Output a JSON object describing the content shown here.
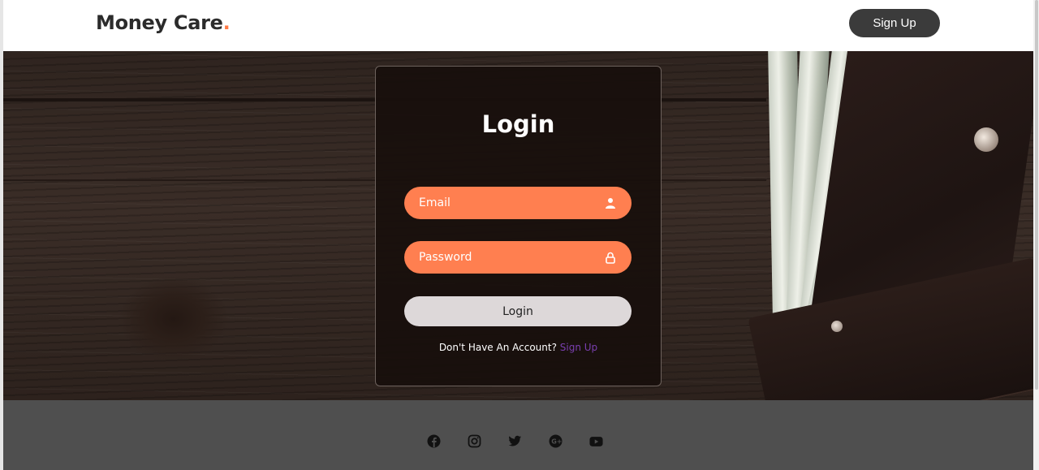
{
  "header": {
    "brand": "Money Care",
    "brand_dot": ".",
    "signup_label": "Sign Up"
  },
  "login": {
    "title": "Login",
    "email_placeholder": "Email",
    "password_placeholder": "Password",
    "button_label": "Login",
    "no_account_text": "Don't Have An Account?",
    "signup_link": "Sign Up"
  },
  "footer": {
    "socials": [
      "facebook-icon",
      "instagram-icon",
      "twitter-icon",
      "google-plus-icon",
      "youtube-icon"
    ]
  },
  "colors": {
    "accent": "#ff7f50",
    "dark_button": "#3b3b3b",
    "link": "#7a3fb0",
    "footer": "#4f4f4f"
  }
}
